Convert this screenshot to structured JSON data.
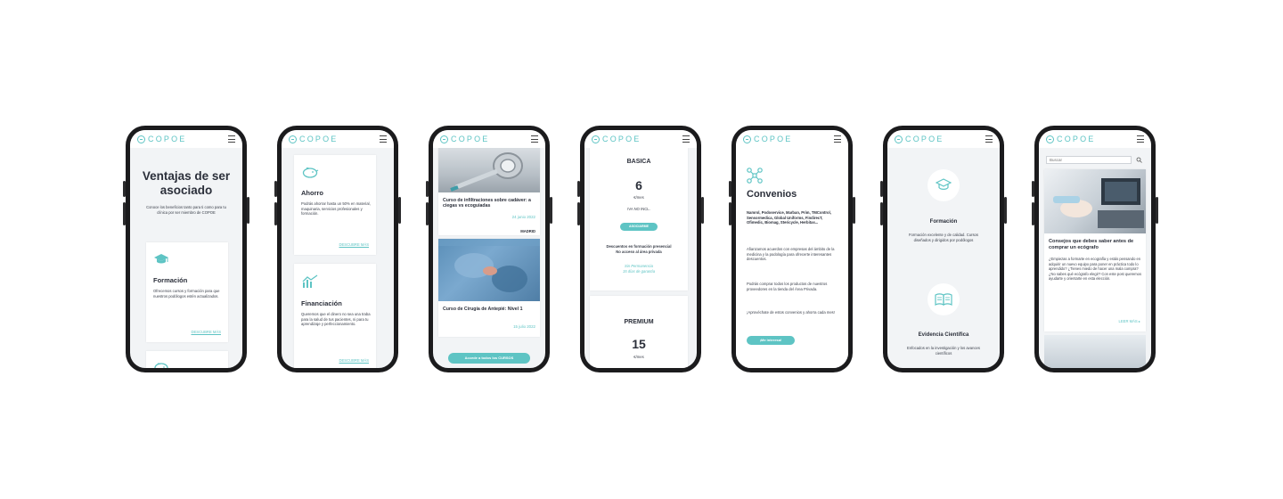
{
  "brand": {
    "logo": "COPOE",
    "accent": "#5ec4c4"
  },
  "phone1": {
    "title": "Ventajas de ser asociado",
    "intro": "Conoce los beneficios tanto para ti como para tu clínica por ser miembro de COPOE",
    "card_title": "Formación",
    "card_text": "Ofrecemos cursos y formación para que nuestros podólogos estén actualizados.",
    "card_link": "DESCUBRE MÁS",
    "icon1": "graduation-cap-icon",
    "icon2": "piggy-bank-icon"
  },
  "phone2": {
    "card1_title": "Ahorro",
    "card1_text": "Podrás ahorrar hasta un 50% en material, maquinaria, servicios profesionales y formación.",
    "card1_link": "DESCUBRE MÁS",
    "card2_title": "Financiación",
    "card2_text": "Queremos que el dinero no sea una traba para la salud de tus pacientes, ni para tu aprendizaje y perfeccionamiento.",
    "card2_link": "DESCUBRE MÁS",
    "icon1": "piggy-bank-icon",
    "icon2": "growth-chart-icon"
  },
  "phone3": {
    "course1_title": "Curso de infiltraciones sobre cadáver: a ciegas vs ecoguiadas",
    "course1_date": "24 junio 2022",
    "course1_city": "MADRID",
    "course2_title": "Curso de Cirugía de Antepié: Nivel 1",
    "course2_date": "15 julio 2022",
    "cta": "Accede a todos los CURSOS"
  },
  "phone4": {
    "plan1_name": "BASICA",
    "plan1_price": "6",
    "plan1_unit": "€/mes",
    "plan1_tax": "IVA NO INCL.",
    "plan1_button": "ASOCIARME",
    "plan1_feature1": "Descuentos en formación presencial",
    "plan1_feature2": "No acceso al área privada",
    "plan1_note1": "Sin Permanencia",
    "plan1_note2": "15 días de garantía",
    "plan2_name": "PREMIUM",
    "plan2_price": "15",
    "plan2_unit": "€/mes"
  },
  "phone5": {
    "title": "Convenios",
    "brands": "Namrol, Podoservice, Marban, Prim, TMControl, Sensormedica, Global Uniforms, FindirecT, Ofimedic, Biomag, Stericycle, Herbitas...",
    "p1": "Afianzamos acuerdos con empresas del ámbito de la medicina y la podología para ofrecerte interesantes descuentos.",
    "p2": "Podrás comprar todos los productos de nuestros proveedores en la tienda del Área Privada.",
    "p3": "¡Aprovéchate de estos convenios y ahorra cada mes!",
    "cta": "¡Me interesa!",
    "icon": "network-icon"
  },
  "phone6": {
    "item1_title": "Formación",
    "item1_text": "Formación excelente y de calidad. Cursos diseñados y dirigidos por podólogos",
    "item2_title": "Evidencia Científica",
    "item2_text": "Enfocados en la investigación y los avances científicos",
    "icon1": "graduation-cap-icon",
    "icon2": "open-book-icon"
  },
  "phone7": {
    "search_placeholder": "Buscar",
    "post_title": "Consejos que debes saber antes de comprar un ecógrafo",
    "post_text": "¿Empiezas a formarte en ecografía y estás pensando en adquirir un nuevo equipo para poner en práctica todo lo aprendido? ¿Tienes miedo de hacer una mala compra? ¿No sabes qué ecógrafo elegir? Con este post queremos ayudarte y orientarte en esta elección.",
    "read_more": "LEER MÁS"
  }
}
